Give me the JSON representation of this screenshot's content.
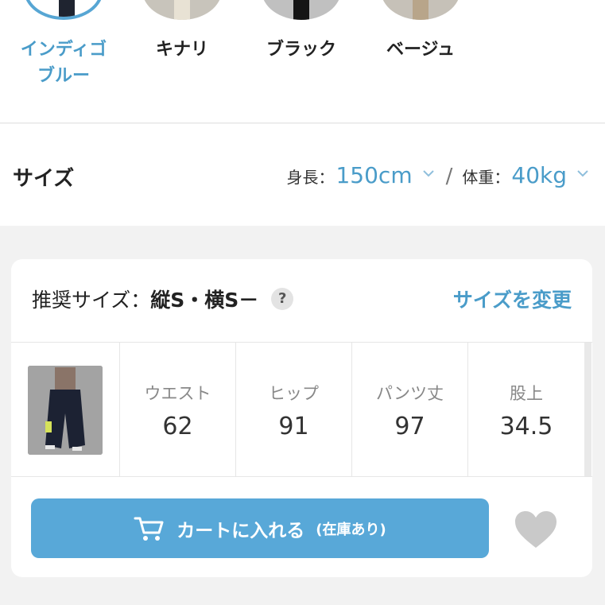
{
  "colors": {
    "items": [
      {
        "label": "インディゴ\nブルー",
        "active": true
      },
      {
        "label": "キナリ",
        "active": false
      },
      {
        "label": "ブラック",
        "active": false
      },
      {
        "label": "ベージュ",
        "active": false
      }
    ]
  },
  "size": {
    "title": "サイズ",
    "height_label": "身長：",
    "height_value": "150cm",
    "separator": "/",
    "weight_label": "体重：",
    "weight_value": "40kg"
  },
  "recommend": {
    "prefix": "推奨サイズ：",
    "value": "縦S・横S－",
    "help": "?",
    "change_label": "サイズを変更"
  },
  "metrics": [
    {
      "label": "ウエスト",
      "value": "62"
    },
    {
      "label": "ヒップ",
      "value": "91"
    },
    {
      "label": "パンツ丈",
      "value": "97"
    },
    {
      "label": "股上",
      "value": "34.5"
    }
  ],
  "cart": {
    "label": "カートに入れる",
    "stock": "(在庫あり)"
  },
  "theme": {
    "accent": "#4a9cc9",
    "button": "#58a8d8",
    "heart": "#c9c9c9"
  }
}
